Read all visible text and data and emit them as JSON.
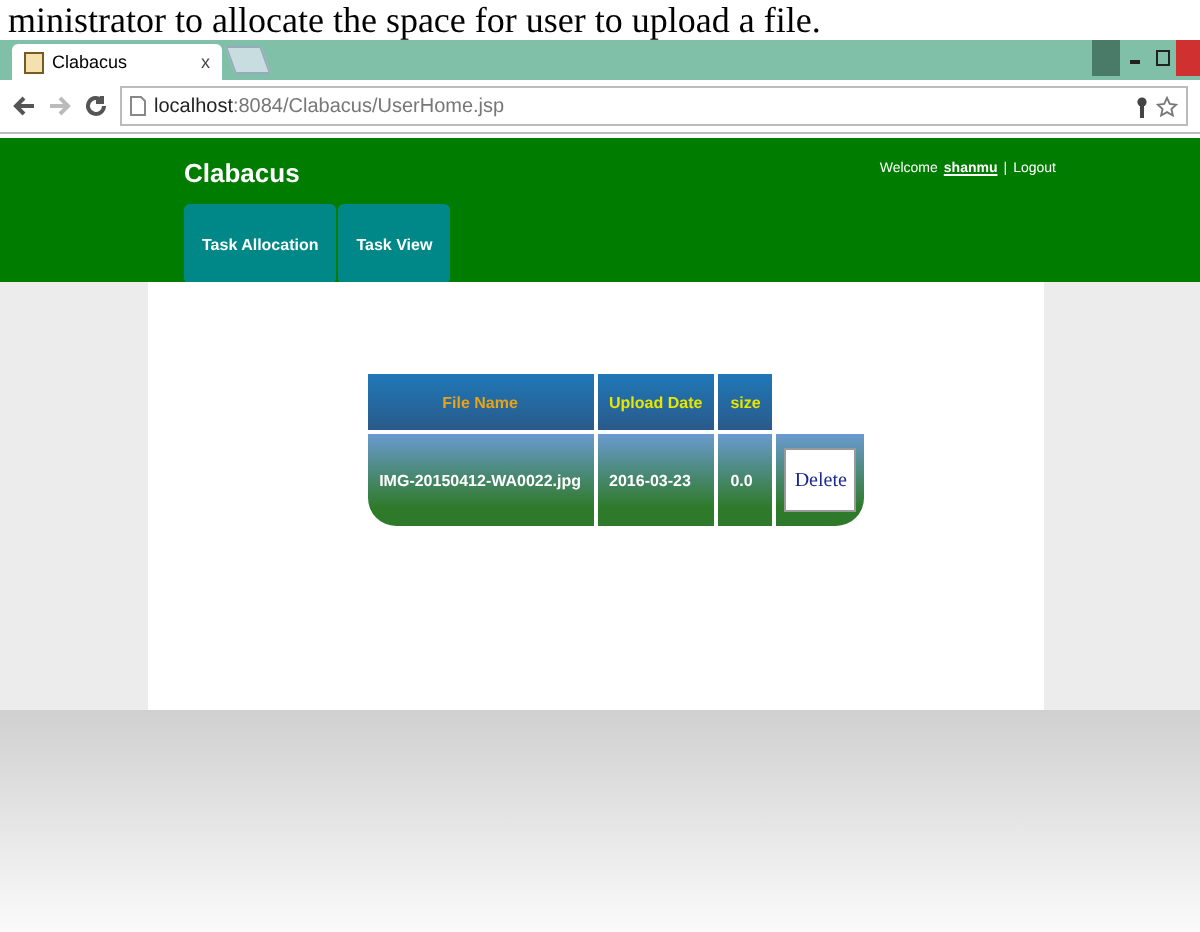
{
  "caption": "ministrator to allocate the space for user to upload a file.",
  "browser": {
    "tab_title": "Clabacus",
    "tab_close": "x",
    "url_host": "localhost",
    "url_path": ":8084/Clabacus/UserHome.jsp"
  },
  "header": {
    "brand": "Clabacus",
    "welcome": "Welcome",
    "user": "shanmu",
    "separator": "|",
    "logout": "Logout"
  },
  "nav": [
    {
      "label": "Task Allocation"
    },
    {
      "label": "Task View"
    }
  ],
  "table": {
    "columns": [
      {
        "label": "File Name"
      },
      {
        "label": "Upload Date"
      },
      {
        "label": "size"
      }
    ],
    "rows": [
      {
        "cells": [
          "IMG-20150412-WA0022.jpg",
          "2016-03-23",
          "0.0"
        ],
        "action": "Delete"
      }
    ]
  }
}
